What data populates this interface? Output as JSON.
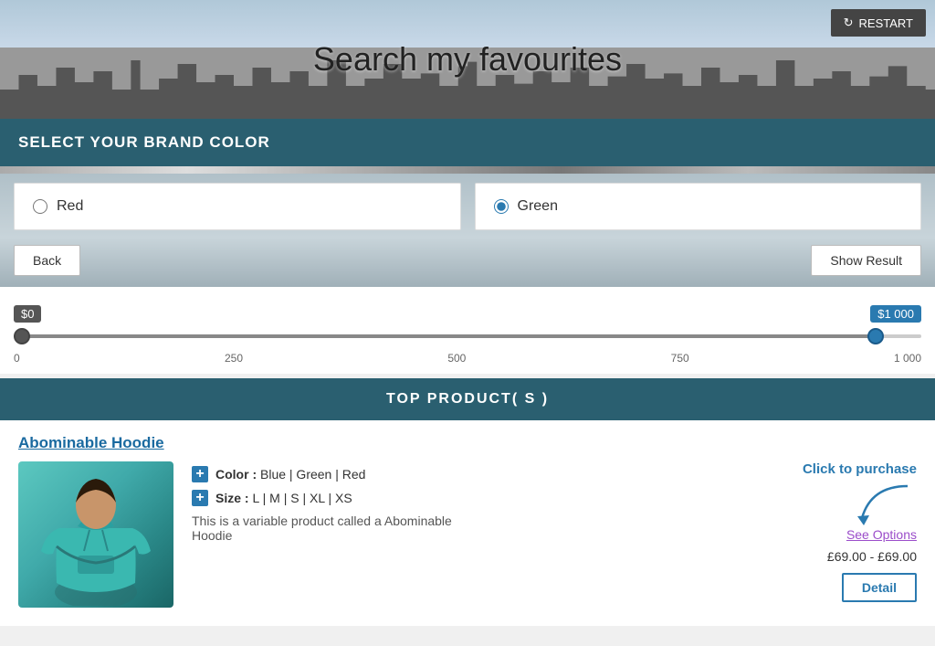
{
  "hero": {
    "title": "Search my favourites",
    "restart_label": "RESTART"
  },
  "brand_section": {
    "header": "SELECT YOUR BRAND COLOR",
    "colors": [
      {
        "id": "red",
        "label": "Red",
        "selected": false
      },
      {
        "id": "green",
        "label": "Green",
        "selected": true
      }
    ]
  },
  "actions": {
    "back_label": "Back",
    "show_result_label": "Show Result"
  },
  "price_range": {
    "min_label": "$0",
    "max_label": "$1 000",
    "ticks": [
      "0",
      "250",
      "500",
      "750",
      "1 000"
    ]
  },
  "top_products": {
    "title": "TOP PRODUCT( S )"
  },
  "product": {
    "name": "Abominable Hoodie",
    "color_label": "Color :",
    "color_values": "Blue | Green | Red",
    "size_label": "Size :",
    "size_values": "L | M | S | XL | XS",
    "description": "This is a variable product called a Abominable Hoodie",
    "see_options": "See Options",
    "price": "£69.00 - £69.00",
    "detail_btn": "Detail",
    "click_to_purchase": "Click to purchase"
  }
}
